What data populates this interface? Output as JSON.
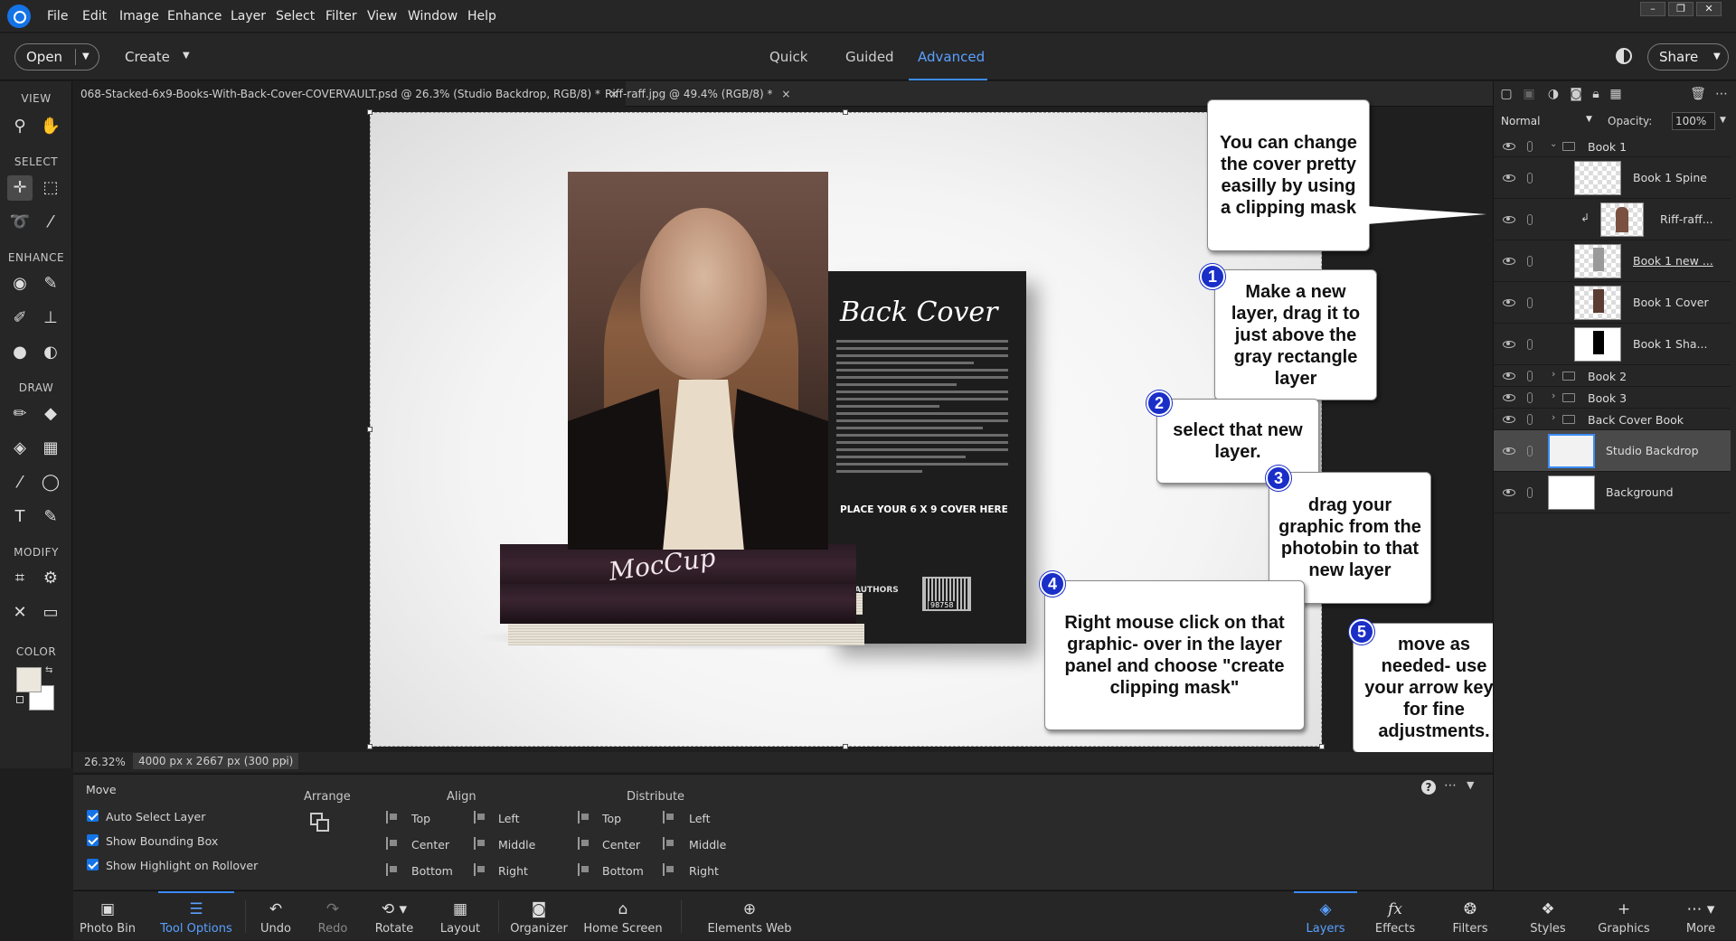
{
  "menubar": {
    "items": [
      "File",
      "Edit",
      "Image",
      "Enhance",
      "Layer",
      "Select",
      "Filter",
      "View",
      "Window",
      "Help"
    ]
  },
  "topbar": {
    "open_label": "Open",
    "create_label": "Create",
    "modes": [
      "Quick",
      "Guided",
      "Advanced"
    ],
    "active_mode": "Advanced",
    "share_label": "Share"
  },
  "toolbar": {
    "sections": [
      "VIEW",
      "SELECT",
      "ENHANCE",
      "DRAW",
      "MODIFY",
      "COLOR"
    ]
  },
  "doc_tabs": [
    {
      "title": "068-Stacked-6x9-Books-With-Back-Cover-COVERVAULT.psd @ 26.3% (Studio Backdrop, RGB/8) *",
      "close": "×"
    },
    {
      "title": "Riff-raff.jpg @ 49.4% (RGB/8) *",
      "close": "×"
    }
  ],
  "canvas": {
    "back_cover_title": "Back Cover",
    "place_text": "PLACE YOUR 6 X 9 COVER HERE",
    "authors_text": "AUTHORS",
    "barcode_number": "98758",
    "stack_title": "MocCup"
  },
  "callouts": {
    "clipping_intro": "You can change the cover pretty easilly by using a clipping mask",
    "step1_num": "1",
    "step1": "Make a new layer, drag it to just above the gray rectangle layer",
    "step2_num": "2",
    "step2": "select that new layer.",
    "step3_num": "3",
    "step3": "drag your graphic from the photobin to that new layer",
    "step4_num": "4",
    "step4": "Right mouse click on that graphic- over in the layer panel and choose \"create clipping mask\"",
    "step5_num": "5",
    "step5": "move as needed- use your arrow keys for fine adjustments."
  },
  "status": {
    "zoom": "26.32%",
    "doc_size": "4000 px x 2667 px (300 ppi)"
  },
  "tool_options": {
    "tool_name": "Move",
    "checkboxes": [
      "Auto Select Layer",
      "Show Bounding Box",
      "Show Highlight on Rollover"
    ],
    "arrange_label": "Arrange",
    "align_label": "Align",
    "align_items": [
      "Top",
      "Center",
      "Bottom",
      "Left",
      "Middle",
      "Right"
    ],
    "distribute_label": "Distribute",
    "distribute_items": [
      "Top",
      "Center",
      "Bottom",
      "Left",
      "Middle",
      "Right"
    ]
  },
  "taskbar": {
    "left": [
      "Photo Bin",
      "Tool Options",
      "Undo",
      "Redo",
      "Rotate",
      "Layout",
      "Organizer",
      "Home Screen",
      "Elements Web"
    ],
    "right": [
      "Layers",
      "Effects",
      "Filters",
      "Styles",
      "Graphics",
      "More"
    ],
    "active_left": "Tool Options",
    "active_right": "Layers"
  },
  "layers_panel": {
    "blend_mode": "Normal",
    "opacity_label": "Opacity:",
    "opacity_value": "100%",
    "layers": [
      {
        "name": "Book 1",
        "type": "group",
        "expanded": true
      },
      {
        "name": "Book 1 Spine",
        "type": "layer"
      },
      {
        "name": "Riff-raff...",
        "type": "clipped"
      },
      {
        "name": "Book 1 new ...",
        "type": "layer"
      },
      {
        "name": "Book 1 Cover",
        "type": "layer"
      },
      {
        "name": "Book 1 Sha...",
        "type": "layer"
      },
      {
        "name": "Book 2",
        "type": "group",
        "expanded": false
      },
      {
        "name": "Book 3",
        "type": "group",
        "expanded": false
      },
      {
        "name": "Back Cover Book",
        "type": "group",
        "expanded": false
      },
      {
        "name": "Studio Backdrop",
        "type": "layer",
        "selected": true
      },
      {
        "name": "Background",
        "type": "layer"
      }
    ]
  },
  "colors": {
    "accent": "#1473e6",
    "step_badge": "#1a2ec8",
    "foreground_swatch": "#ece7dd",
    "background_swatch": "#ffffff"
  }
}
